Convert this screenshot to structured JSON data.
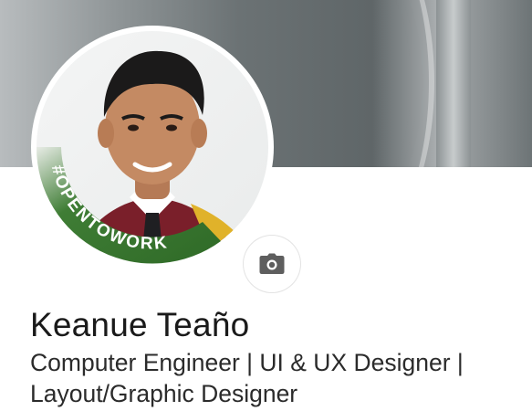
{
  "profile": {
    "name": "Keanue Teaño",
    "headline": "Computer Engineer | UI & UX Designer | Layout/Graphic Designer",
    "frame_badge": "#OPENTOWORK"
  },
  "icons": {
    "camera": "camera-icon"
  },
  "colors": {
    "frame_green": "#3b7a32",
    "cover_gray": "#6b7274",
    "text": "#1a1a1a"
  }
}
